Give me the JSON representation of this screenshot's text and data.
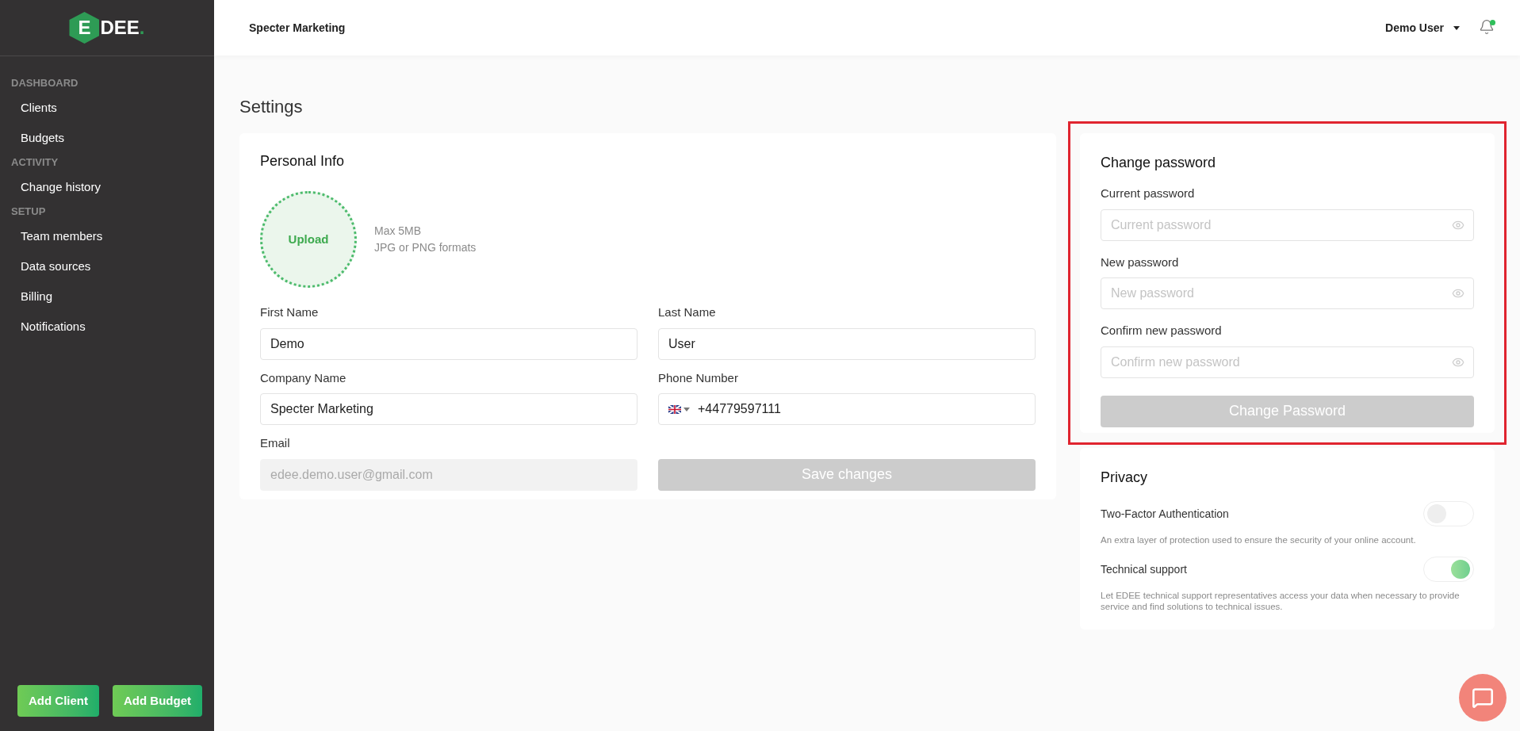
{
  "logo": {
    "mark": "E",
    "text": "DEE",
    "dot": "."
  },
  "sidebar": {
    "sections": [
      {
        "title": "DASHBOARD",
        "items": [
          {
            "label": "Clients",
            "selected": false
          },
          {
            "label": "Budgets",
            "selected": false
          }
        ]
      },
      {
        "title": "ACTIVITY",
        "items": [
          {
            "label": "Change history",
            "selected": false
          }
        ]
      },
      {
        "title": "SETUP",
        "items": [
          {
            "label": "Team members",
            "selected": false
          },
          {
            "label": "Data sources",
            "selected": false
          },
          {
            "label": "Billing",
            "selected": false
          },
          {
            "label": "Notifications",
            "selected": false
          }
        ]
      }
    ],
    "buttons": [
      "Add Client",
      "Add Budget"
    ]
  },
  "header": {
    "company": "Specter Marketing",
    "user": "Demo User",
    "notification_unread": true
  },
  "page_title": "Settings",
  "personal_info": {
    "title": "Personal Info",
    "upload": {
      "label": "Upload",
      "hint_lines": [
        "Max 5MB",
        "JPG or PNG formats"
      ]
    },
    "fields": [
      {
        "kind": "text",
        "label": "First Name",
        "value": "Demo"
      },
      {
        "kind": "text",
        "label": "Last Name",
        "value": "User"
      },
      {
        "kind": "text",
        "label": "Company Name",
        "value": "Specter Marketing"
      },
      {
        "kind": "phone",
        "label": "Phone Number",
        "value": "+44779597111"
      },
      {
        "kind": "text",
        "label": "Email",
        "value": "edee.demo.user@gmail.com",
        "disabled": true
      }
    ],
    "save_button": {
      "label": "Save changes",
      "disabled": true
    }
  },
  "change_password": {
    "title": "Change password",
    "highlighted": true,
    "fields": [
      {
        "label": "Current password",
        "placeholder": "Current password"
      },
      {
        "label": "New password",
        "placeholder": "New password"
      },
      {
        "label": "Confirm new password",
        "placeholder": "Confirm new password"
      }
    ],
    "button": {
      "label": "Change Password",
      "disabled": true
    }
  },
  "privacy": {
    "title": "Privacy",
    "settings": [
      {
        "label": "Two-Factor Authentication",
        "on": false,
        "description": "An extra layer of protection used to ensure the security of your online account."
      },
      {
        "label": "Technical support",
        "on": true,
        "description": "Let EDEE technical support representatives access your data when necessary to provide service and find solutions to technical issues."
      }
    ]
  }
}
